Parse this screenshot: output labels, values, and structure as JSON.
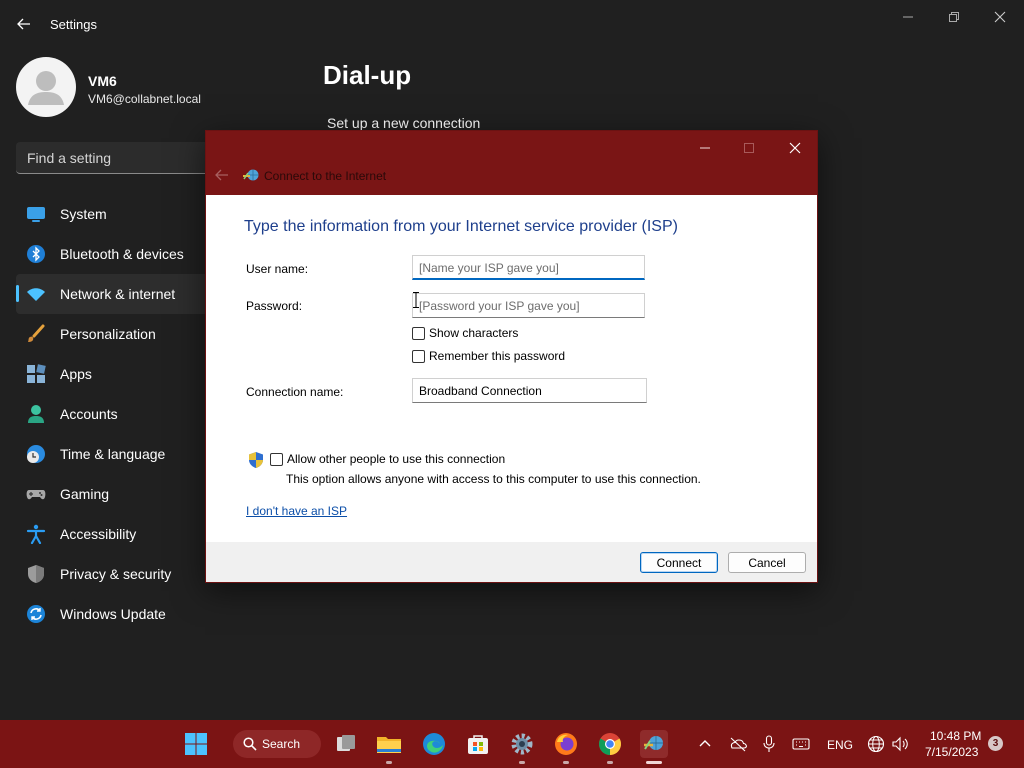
{
  "window": {
    "app_title": "Settings"
  },
  "profile": {
    "name": "VM6",
    "email": "VM6@collabnet.local"
  },
  "search": {
    "placeholder": "Find a setting"
  },
  "sidebar": {
    "items": [
      {
        "label": "System",
        "icon": "monitor-icon"
      },
      {
        "label": "Bluetooth & devices",
        "icon": "bluetooth-icon"
      },
      {
        "label": "Network & internet",
        "icon": "wifi-icon",
        "active": true
      },
      {
        "label": "Personalization",
        "icon": "brush-icon"
      },
      {
        "label": "Apps",
        "icon": "apps-icon"
      },
      {
        "label": "Accounts",
        "icon": "person-icon"
      },
      {
        "label": "Time & language",
        "icon": "globe-clock-icon"
      },
      {
        "label": "Gaming",
        "icon": "gamepad-icon"
      },
      {
        "label": "Accessibility",
        "icon": "accessibility-icon"
      },
      {
        "label": "Privacy & security",
        "icon": "shield-icon"
      },
      {
        "label": "Windows Update",
        "icon": "update-icon"
      }
    ]
  },
  "main": {
    "title": "Dial-up",
    "setup_link": "Set up a new connection"
  },
  "dialog": {
    "title": "Connect to the Internet",
    "heading": "Type the information from your Internet service provider (ISP)",
    "user_name_label": "User name:",
    "user_name_placeholder": "[Name your ISP gave you]",
    "password_label": "Password:",
    "password_placeholder": "[Password your ISP gave you]",
    "show_characters": "Show characters",
    "remember_password": "Remember this password",
    "connection_name_label": "Connection name:",
    "connection_name_value": "Broadband Connection",
    "allow_others": "Allow other people to use this connection",
    "allow_others_note": "This option allows anyone with access to this computer to use this connection.",
    "no_isp_link": "I don't have an ISP",
    "connect_button": "Connect",
    "cancel_button": "Cancel"
  },
  "taskbar": {
    "search_label": "Search",
    "language": "ENG",
    "time": "10:48 PM",
    "date": "7/15/2023",
    "notification_count": "3",
    "accent_color": "#7b1414"
  }
}
